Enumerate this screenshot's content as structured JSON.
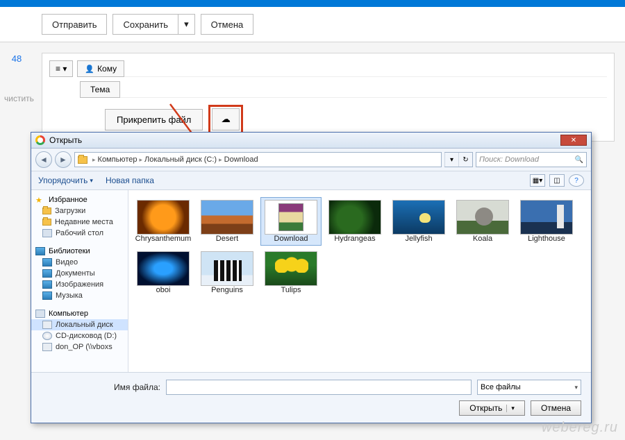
{
  "toolbar": {
    "send": "Отправить",
    "save": "Сохранить",
    "cancel": "Отмена"
  },
  "left": {
    "count": "48",
    "clear": "чистить"
  },
  "compose": {
    "toggle": "≡ ▾",
    "to_label": "Кому",
    "subject_label": "Тема",
    "attach_label": "Прикрепить файл"
  },
  "dialog": {
    "title": "Открыть",
    "path": {
      "root": "Компьютер",
      "drive": "Локальный диск (C:)",
      "folder": "Download"
    },
    "search_placeholder": "Поиск: Download",
    "organize": "Упорядочить",
    "new_folder": "Новая папка",
    "sidebar": {
      "fav_header": "Избранное",
      "downloads": "Загрузки",
      "recent": "Недавние места",
      "desktop": "Рабочий стол",
      "lib_header": "Библиотеки",
      "video": "Видео",
      "docs": "Документы",
      "images": "Изображения",
      "music": "Музыка",
      "comp_header": "Компьютер",
      "local": "Локальный диск",
      "cd": "CD-дисковод (D:)",
      "don": "don_OP (\\\\vboxs"
    },
    "files": [
      "Chrysanthemum",
      "Desert",
      "Download",
      "Hydrangeas",
      "Jellyfish",
      "Koala",
      "Lighthouse",
      "oboi",
      "Penguins",
      "Tulips"
    ],
    "fname_label": "Имя файла:",
    "filter": "Все файлы",
    "open_btn": "Открыть",
    "cancel_btn": "Отмена"
  },
  "watermark": "webereg.ru"
}
